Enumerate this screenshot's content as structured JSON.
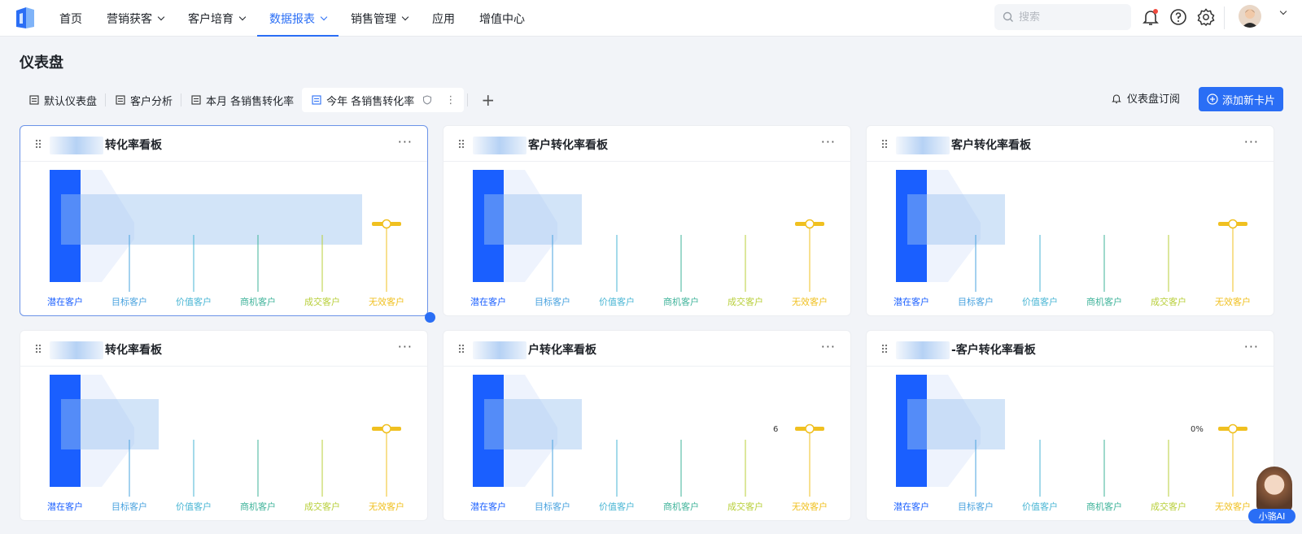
{
  "nav": {
    "items": [
      {
        "label": "首页",
        "dropdown": false
      },
      {
        "label": "营销获客",
        "dropdown": true
      },
      {
        "label": "客户培育",
        "dropdown": true
      },
      {
        "label": "数据报表",
        "dropdown": true,
        "active": true
      },
      {
        "label": "销售管理",
        "dropdown": true
      },
      {
        "label": "应用",
        "dropdown": false
      },
      {
        "label": "增值中心",
        "dropdown": false
      }
    ],
    "search_placeholder": "搜索",
    "icons": [
      "bell-icon",
      "help-icon",
      "settings-icon"
    ]
  },
  "page": {
    "title": "仪表盘",
    "tabs": [
      {
        "label": "默认仪表盘"
      },
      {
        "label": "客户分析"
      },
      {
        "label": "本月 各销售转化率"
      },
      {
        "label": "今年 各销售转化率",
        "active": true
      }
    ],
    "subscribe_label": "仪表盘订阅",
    "add_card_label": "添加新卡片"
  },
  "cards": [
    {
      "title": "转化率看板"
    },
    {
      "title": "客户转化率看板"
    },
    {
      "title": "客户转化率看板"
    },
    {
      "title": "转化率看板"
    },
    {
      "title": "户转化率看板"
    },
    {
      "title": "-客户转化率看板"
    }
  ],
  "funnel_stages": [
    "潜在客户",
    "目标客户",
    "价值客户",
    "商机客户",
    "成交客户",
    "无效客户"
  ],
  "stage_colors": [
    "#1a5fff",
    "#4aa3df",
    "#4ab6d4",
    "#3fb39a",
    "#b8cf3a",
    "#f0c020"
  ],
  "partial_labels": {
    "card5": "6",
    "card6": "0%"
  },
  "ai_assistant": {
    "label": "小骆AI"
  },
  "colors": {
    "accent": "#2a6ef5"
  }
}
